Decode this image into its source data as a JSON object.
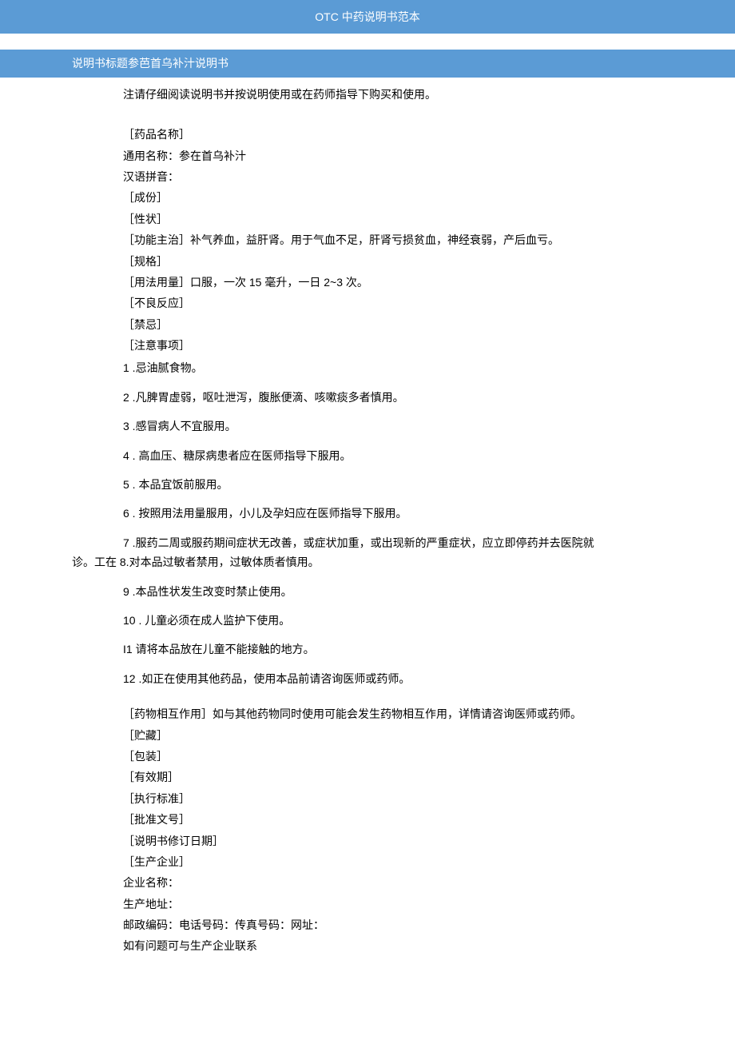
{
  "header": {
    "title": "OTC 中药说明书范本"
  },
  "subheader": {
    "text": "说明书标题参芭首乌补汁说明书"
  },
  "notice": "注请仔细阅读说明书并按说明使用或在药师指导下购买和使用。",
  "fields": {
    "drug_name_label": "［药品名称］",
    "generic_name": "通用名称：参在首乌补汁",
    "pinyin": "汉语拼音：",
    "ingredients": "［成份］",
    "properties": "［性状］",
    "indications": "［功能主治］补气养血，益肝肾。用于气血不足，肝肾亏损贫血，神经衰弱，产后血亏。",
    "spec": "［规格］",
    "dosage": "［用法用量］口服，一次 15 毫升，一日 2~3 次。",
    "adverse": "［不良反应］",
    "contra": "［禁忌］",
    "precautions": "［注意事项］"
  },
  "items": {
    "i1": "1  .忌油腻食物。",
    "i2": "2  .凡脾胃虚弱，呕吐泄泻，腹胀便滴、咳嗽痰多者慎用。",
    "i3": "3  .感冒病人不宜服用。",
    "i4": "4  . 高血压、糖尿病患者应在医师指导下服用。",
    "i5": "5  . 本品宜饭前服用。",
    "i6": "6  . 按照用法用量服用，小儿及孕妇应在医师指导下服用。",
    "i7a": "7  .服药二周或服药期间症状无改善，或症状加重，或出现新的严重症状，应立即停药并去医院就",
    "i7b": "诊。工在 8.对本品过敏者禁用，过敏体质者慎用。",
    "i9": "9  .本品性状发生改变时禁止使用。",
    "i10": "10  . 儿童必须在成人监护下使用。",
    "i11": "I1 请将本品放在儿童不能接触的地方。",
    "i12": "12  .如正在使用其他药品，使用本品前请咨询医师或药师。"
  },
  "tail": {
    "interaction": "［药物相互作用］如与其他药物同时使用可能会发生药物相互作用，详情请咨询医师或药师。",
    "storage": "［贮藏］",
    "package": "［包装］",
    "validity": "［有效期］",
    "standard": "［执行标准］",
    "approval": "［批准文号］",
    "revise_date": "［说明书修订日期］",
    "manufacturer_label": "［生产企业］",
    "company_name": "企业名称：",
    "address": "生产地址：",
    "contacts": "邮政编码：电话号码：传真号码：网址：",
    "contact_note": "如有问题可与生产企业联系"
  }
}
